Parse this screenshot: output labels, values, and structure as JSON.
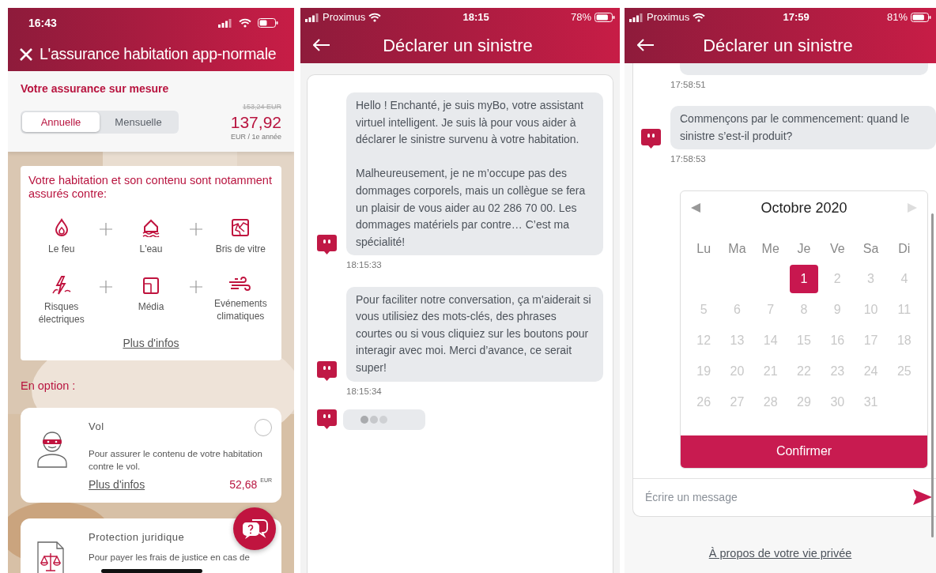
{
  "screens": [
    {
      "kind": "insurance",
      "status_bar": {
        "time": "16:43"
      },
      "header": {
        "title": "L'assurance habitation app-normale"
      },
      "pricing": {
        "heading": "Votre assurance sur mesure",
        "periods": [
          {
            "label": "Annuelle",
            "selected": true
          },
          {
            "label": "Mensuelle",
            "selected": false
          }
        ],
        "old_price": "153,24 EUR",
        "price": "137,92",
        "price_unit": "EUR / 1e année"
      },
      "coverage": {
        "heading": "Votre habitation et son contenu sont notamment assurés contre:",
        "perils": [
          {
            "label": "Le feu"
          },
          {
            "label": "L'eau"
          },
          {
            "label": "Bris de vitre"
          },
          {
            "label": "Risques électriques"
          },
          {
            "label": "Média"
          },
          {
            "label": "Evénements climatiques"
          }
        ],
        "link": "Plus d'infos"
      },
      "options_heading": "En option :",
      "options": [
        {
          "title": "Vol",
          "description": "Pour assurer le contenu de votre habitation contre le vol.",
          "link": "Plus d'infos",
          "price": "52,68",
          "currency": "EUR",
          "selected": false
        },
        {
          "title": "Protection juridique",
          "description": "Pour payer les frais de justice en cas de"
        }
      ]
    },
    {
      "kind": "chat",
      "status_bar": {
        "carrier": "Proximus",
        "time": "18:15",
        "battery": "78%"
      },
      "header": {
        "title": "Déclarer un sinistre"
      },
      "messages": [
        {
          "paragraphs": [
            "Hello ! Enchanté, je suis myBo, votre assistant virtuel intelligent. Je suis là pour vous aider à déclarer le sinistre survenu à votre habitation.",
            "Malheureusement, je ne m’occupe pas des dommages corporels, mais un collègue se fera un plaisir de vous aider au 02 286 70 00. Les dommages matériels par contre… C’est ma spécialité!"
          ],
          "time": "18:15:33"
        },
        {
          "paragraphs": [
            "Pour faciliter notre conversation, ça m'aiderait si vous utilisiez des mots-clés, des phrases courtes ou si vous cliquiez sur les boutons pour interagir avec moi. Merci d’avance, ce serait super!"
          ],
          "time": "18:15:34"
        }
      ],
      "typing": true
    },
    {
      "kind": "chat",
      "status_bar": {
        "carrier": "Proximus",
        "time": "17:59",
        "battery": "81%"
      },
      "header": {
        "title": "Déclarer un sinistre"
      },
      "messages": [
        {
          "time": "17:58:51"
        },
        {
          "paragraphs": [
            "Commençons par le commencement: quand le sinistre s’est-il produit?"
          ],
          "time": "17:58:53"
        }
      ],
      "calendar": {
        "month": "Octobre 2020",
        "weekdays": [
          "Lu",
          "Ma",
          "Me",
          "Je",
          "Ve",
          "Sa",
          "Di"
        ],
        "weeks": [
          [
            {
              "label": "1",
              "selected": true,
              "disabled": false
            },
            {
              "label": "2",
              "selected": false,
              "disabled": true
            },
            {
              "label": "3",
              "selected": false,
              "disabled": true
            },
            {
              "label": "4",
              "selected": false,
              "disabled": true
            }
          ],
          [
            {
              "label": "5",
              "selected": false,
              "disabled": true
            },
            {
              "label": "6",
              "selected": false,
              "disabled": true
            },
            {
              "label": "7",
              "selected": false,
              "disabled": true
            },
            {
              "label": "8",
              "selected": false,
              "disabled": true
            },
            {
              "label": "9",
              "selected": false,
              "disabled": true
            },
            {
              "label": "10",
              "selected": false,
              "disabled": true
            },
            {
              "label": "11",
              "selected": false,
              "disabled": true
            }
          ],
          [
            {
              "label": "12",
              "selected": false,
              "disabled": true
            },
            {
              "label": "13",
              "selected": false,
              "disabled": true
            },
            {
              "label": "14",
              "selected": false,
              "disabled": true
            },
            {
              "label": "15",
              "selected": false,
              "disabled": true
            },
            {
              "label": "16",
              "selected": false,
              "disabled": true
            },
            {
              "label": "17",
              "selected": false,
              "disabled": true
            },
            {
              "label": "18",
              "selected": false,
              "disabled": true
            }
          ],
          [
            {
              "label": "19",
              "selected": false,
              "disabled": true
            },
            {
              "label": "20",
              "selected": false,
              "disabled": true
            },
            {
              "label": "21",
              "selected": false,
              "disabled": true
            },
            {
              "label": "22",
              "selected": false,
              "disabled": true
            },
            {
              "label": "23",
              "selected": false,
              "disabled": true
            },
            {
              "label": "24",
              "selected": false,
              "disabled": true
            },
            {
              "label": "25",
              "selected": false,
              "disabled": true
            }
          ],
          [
            {
              "label": "26",
              "selected": false,
              "disabled": true
            },
            {
              "label": "27",
              "selected": false,
              "disabled": true
            },
            {
              "label": "28",
              "selected": false,
              "disabled": true
            },
            {
              "label": "29",
              "selected": false,
              "disabled": true
            },
            {
              "label": "30",
              "selected": false,
              "disabled": true
            },
            {
              "label": "31",
              "selected": false,
              "disabled": true
            }
          ]
        ],
        "confirm": "Confirmer"
      },
      "composer": {
        "placeholder": "Écrire un message"
      },
      "privacy_link": "À propos de votre vie privée"
    }
  ]
}
